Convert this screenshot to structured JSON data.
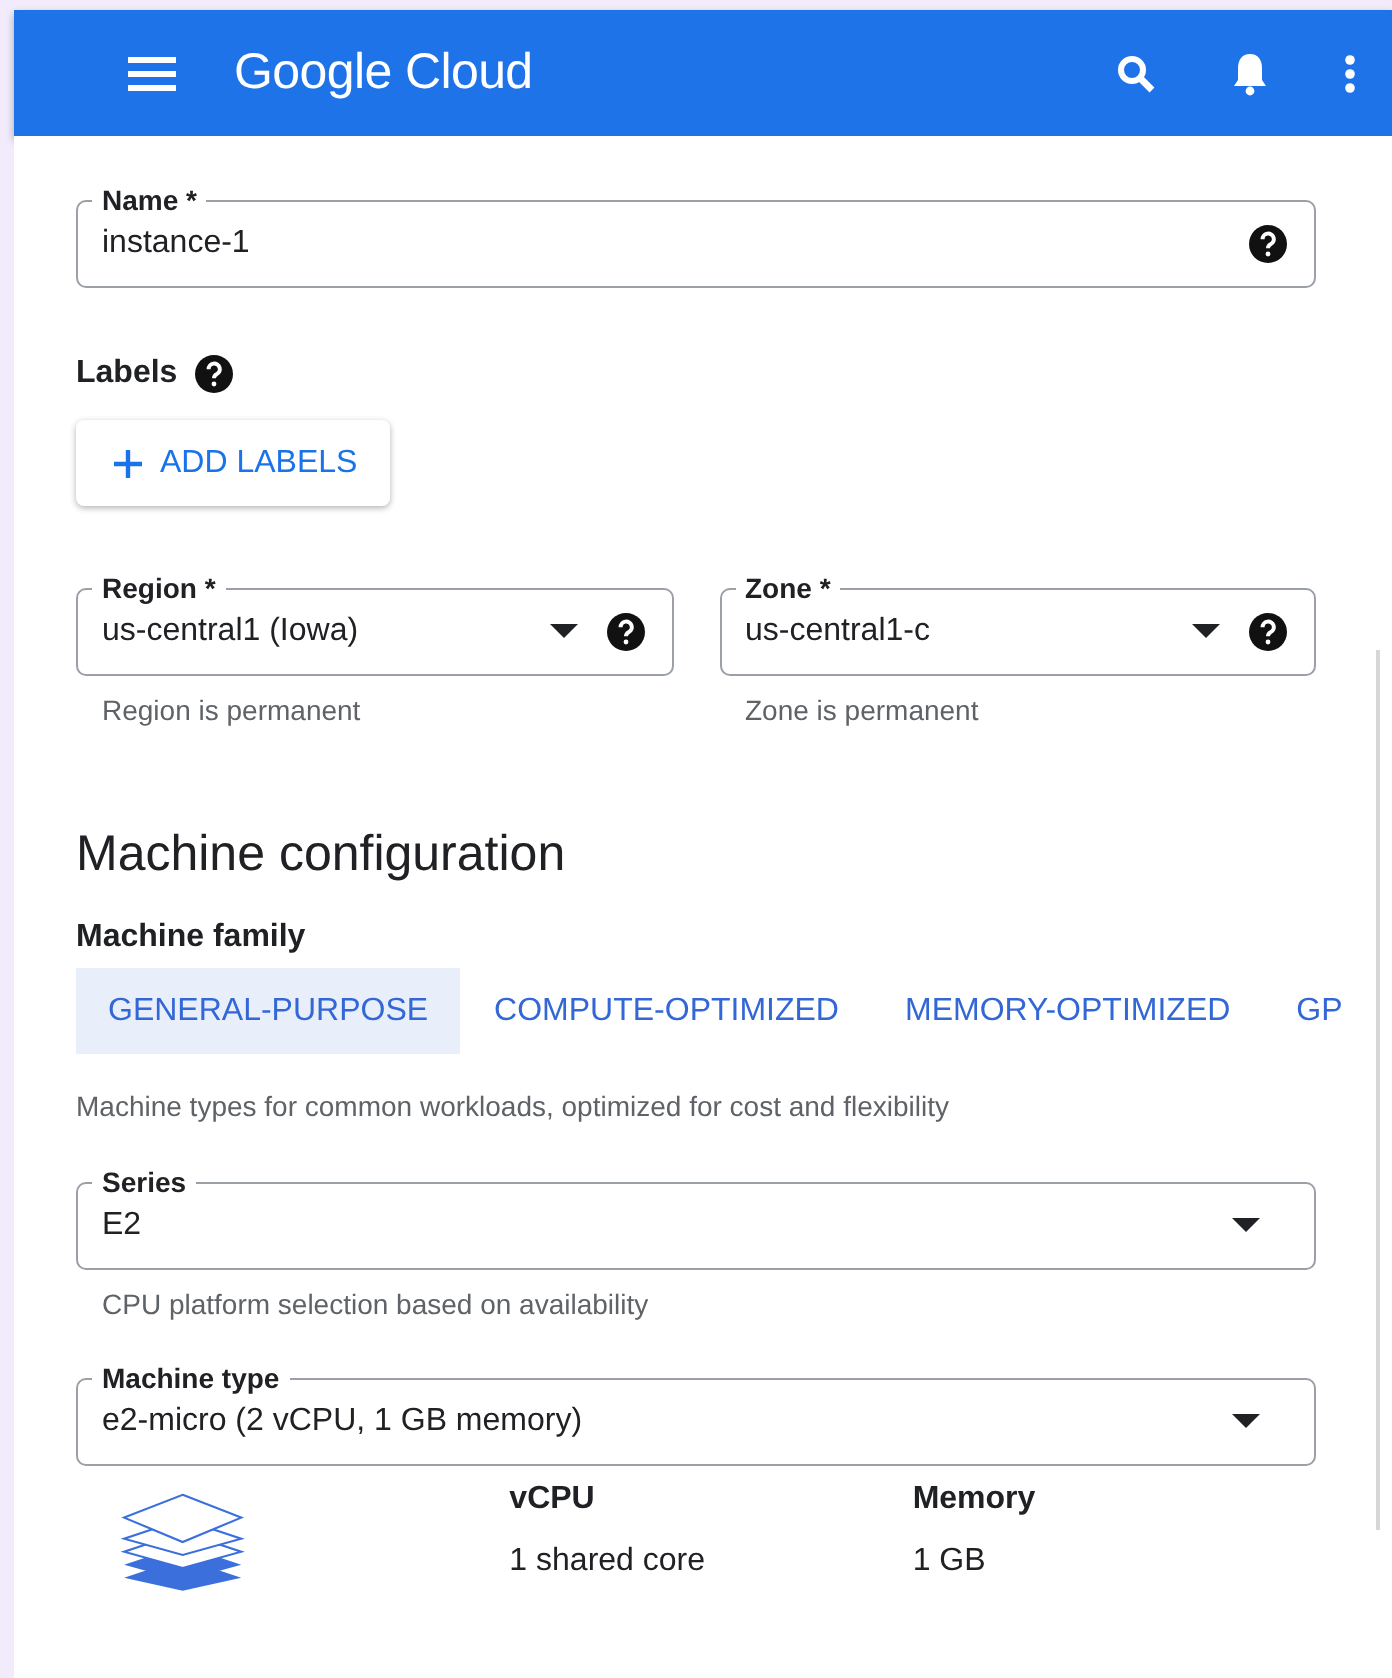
{
  "header": {
    "title": "Google Cloud"
  },
  "name_field": {
    "label": "Name *",
    "value": "instance-1"
  },
  "labels": {
    "title": "Labels",
    "button": "ADD LABELS"
  },
  "location": [
    {
      "label": "Region *",
      "value": "us-central1 (Iowa)",
      "helper": "Region is permanent"
    },
    {
      "label": "Zone *",
      "value": "us-central1-c",
      "helper": "Zone is permanent"
    }
  ],
  "machine": {
    "heading": "Machine configuration",
    "family_label": "Machine family",
    "tabs": [
      {
        "label": "GENERAL-PURPOSE",
        "selected": true
      },
      {
        "label": "COMPUTE-OPTIMIZED",
        "selected": false
      },
      {
        "label": "MEMORY-OPTIMIZED",
        "selected": false
      },
      {
        "label": "GP",
        "selected": false
      }
    ],
    "description": "Machine types for common workloads, optimized for cost and flexibility",
    "series": {
      "label": "Series",
      "value": "E2",
      "helper": "CPU platform selection based on availability"
    },
    "machine_type": {
      "label": "Machine type",
      "value": "e2-micro (2 vCPU, 1 GB memory)"
    },
    "specs": [
      {
        "title": "vCPU",
        "value": "1 shared core"
      },
      {
        "title": "Memory",
        "value": "1 GB"
      }
    ]
  }
}
